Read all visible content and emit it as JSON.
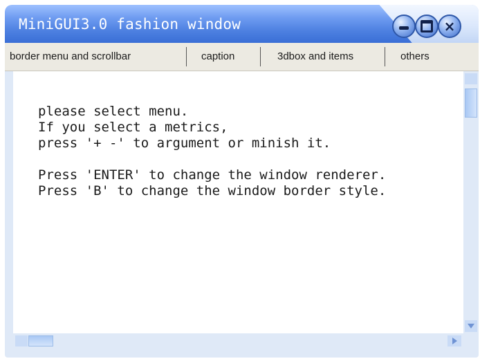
{
  "window": {
    "title": "MiniGUI3.0 fashion window",
    "controls": {
      "minimize_icon": "minimize-icon",
      "maximize_icon": "maximize-icon",
      "close_icon": "close-icon",
      "close_glyph": "×"
    }
  },
  "menu": {
    "items": [
      {
        "label": "border menu and scrollbar"
      },
      {
        "label": "caption"
      },
      {
        "label": "3dbox and items"
      },
      {
        "label": "others"
      }
    ]
  },
  "content": {
    "lines": [
      "please select menu.",
      "If you select a metrics,",
      "press '+ -' to argument or minish it.",
      "",
      "Press 'ENTER' to change the window renderer.",
      "Press 'B' to change the window border style."
    ]
  },
  "colors": {
    "title_blue": "#4c7fe0",
    "menu_bg": "#eceae2",
    "scroll_bg": "#dfe9f7"
  }
}
